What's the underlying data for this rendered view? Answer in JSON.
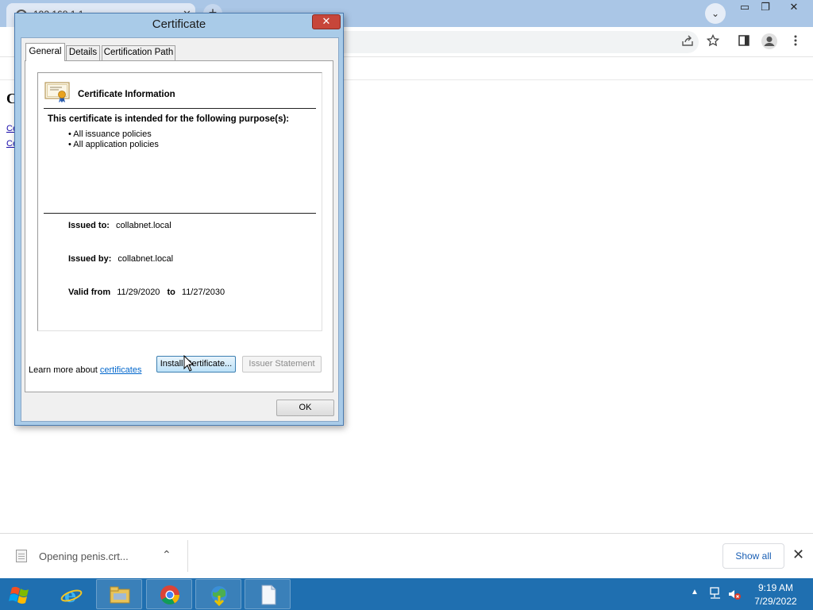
{
  "browser": {
    "tab_title": "192.168.1.1",
    "tab_close": "✕",
    "new_tab": "+",
    "tab_search": "⌄",
    "win_min": "▭",
    "win_max": "❐",
    "win_close": "✕",
    "page_heading_initial": "C",
    "page_link_1": "Ce",
    "page_link_2": "Ce"
  },
  "dialog": {
    "title": "Certificate",
    "close_glyph": "✕",
    "tabs": [
      {
        "label": "General"
      },
      {
        "label": "Details"
      },
      {
        "label": "Certification Path"
      }
    ],
    "info_title": "Certificate Information",
    "purpose_heading": "This certificate is intended for the following purpose(s):",
    "purposes": [
      "• All issuance policies",
      "• All application policies"
    ],
    "issued_to_label": "Issued to:",
    "issued_to_value": "collabnet.local",
    "issued_by_label": "Issued by:",
    "issued_by_value": "collabnet.local",
    "valid_from_label": "Valid from",
    "valid_from_value": "11/29/2020",
    "valid_to_label": "to",
    "valid_to_value": "11/27/2030",
    "install_button": "Install Certificate...",
    "issuer_statement_button": "Issuer Statement",
    "learn_more_prefix": "Learn more about ",
    "learn_more_link": "certificates",
    "ok_button": "OK"
  },
  "download_shelf": {
    "file_label": "Opening penis.crt...",
    "chevron": "⌃",
    "show_all": "Show all",
    "close": "✕"
  },
  "taskbar": {
    "tray_arrow": "▲",
    "time": "9:19 AM",
    "date": "7/29/2022"
  },
  "colors": {
    "taskbar": "#1f6fb0",
    "dialog_frame": "#a9cbe8",
    "link": "#0066cc",
    "close_red": "#c7463a"
  }
}
